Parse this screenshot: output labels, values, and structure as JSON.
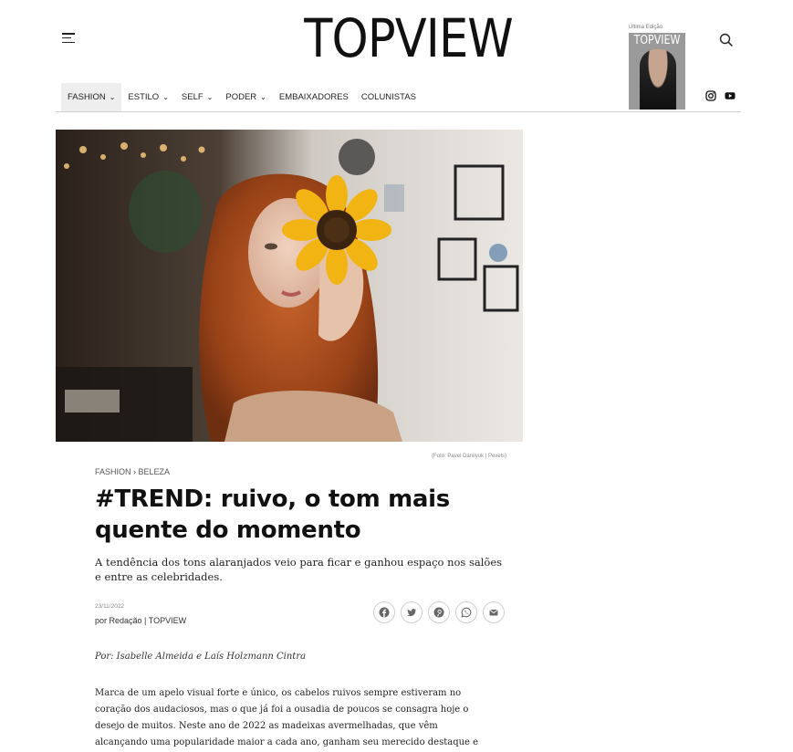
{
  "header": {
    "logo": "TOPVIEW",
    "edition_label": "Última Edição",
    "edition_cover_title": "TOPVIEW"
  },
  "nav": {
    "items": [
      {
        "label": "FASHION",
        "dropdown": true,
        "active": true
      },
      {
        "label": "ESTILO",
        "dropdown": true
      },
      {
        "label": "SELF",
        "dropdown": true
      },
      {
        "label": "PODER",
        "dropdown": true
      },
      {
        "label": "EMBAIXADORES",
        "dropdown": false
      },
      {
        "label": "COLUNISTAS",
        "dropdown": false
      }
    ],
    "social_icons": [
      "instagram-icon",
      "youtube-icon"
    ]
  },
  "article": {
    "photo_credit": "(Foto: Pavel Danilyuk | Pexels)",
    "breadcrumb": {
      "section": "FASHION",
      "separator": "›",
      "subsection": "BELEZA"
    },
    "headline": "#TREND: ruivo, o tom mais quente do momento",
    "dek": "A tendência dos tons alaranjados veio para ficar e ganhou espaço nos salões e entre as celebridades.",
    "date": "23/11/2022",
    "byline_prefix": "por",
    "byline_author": "Redação | TOPVIEW",
    "authors_line": "Por: Isabelle Almeida e Laís Holzmann Cintra",
    "body": "Marca de um apelo visual forte e único, os cabelos ruivos sempre estiveram no coração dos audaciosos, mas o que já foi a ousadia de poucos se consagra hoje o desejo de muitos. Neste ano de 2022 as madeixas avermelhadas, que vêm alcançando uma popularidade maior a cada ano, ganham seu merecido destaque e se tornam a tendência do momento."
  },
  "share_icons": [
    "facebook-icon",
    "twitter-icon",
    "pinterest-icon",
    "whatsapp-icon",
    "email-icon"
  ],
  "colors": {
    "accent": "#111111",
    "nav_active_bg": "#eeeeee",
    "hair": "#b4521f",
    "sunflower": "#f2b413"
  }
}
